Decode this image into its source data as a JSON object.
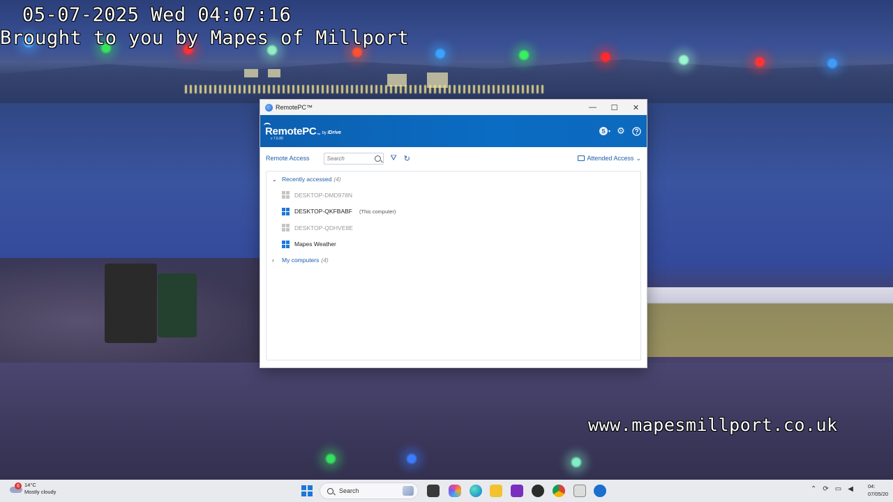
{
  "overlay": {
    "datetime": "05-07-2025 Wed 04:07:16",
    "credit": "Brought to you by Mapes of Millport",
    "url": "www.mapesmillport.co.uk"
  },
  "window": {
    "title": "RemotePC™",
    "controls": {
      "minimize": "—",
      "maximize": "☐",
      "close": "✕"
    }
  },
  "app": {
    "logo_brand": "RemotePC",
    "logo_tm": "™",
    "logo_by": "by",
    "logo_idrive": "IDrive",
    "version": "v 7.6.89",
    "account_initial": "S",
    "caret": "▾"
  },
  "toolbar": {
    "tab_label": "Remote Access",
    "search_placeholder": "Search",
    "filter_icon": "⛛",
    "refresh_icon": "↻",
    "attended_label": "Attended Access",
    "attended_caret": "⌄"
  },
  "groups": {
    "recent": {
      "label": "Recently accessed",
      "count": "(4)",
      "chevron": "⌄"
    },
    "mine": {
      "label": "My computers",
      "count": "(4)",
      "chevron": "›"
    }
  },
  "computers": [
    {
      "name": "DESKTOP-DMD978N",
      "tag": "",
      "online": false
    },
    {
      "name": "DESKTOP-QKFBABF",
      "tag": "(This computer)",
      "online": true
    },
    {
      "name": "DESKTOP-QDHVE8E",
      "tag": "",
      "online": false
    },
    {
      "name": "Mapes Weather",
      "tag": "",
      "online": true
    }
  ],
  "taskbar": {
    "weather_temp": "14°C",
    "weather_desc": "Mostly cloudy",
    "weather_badge": "6",
    "search_label": "Search",
    "clock_time": "04:",
    "clock_date": "07/05/20"
  },
  "colors": {
    "accent": "#1f5fa9",
    "header": "#0d63b6",
    "windows_blue": "#1e78d6"
  }
}
